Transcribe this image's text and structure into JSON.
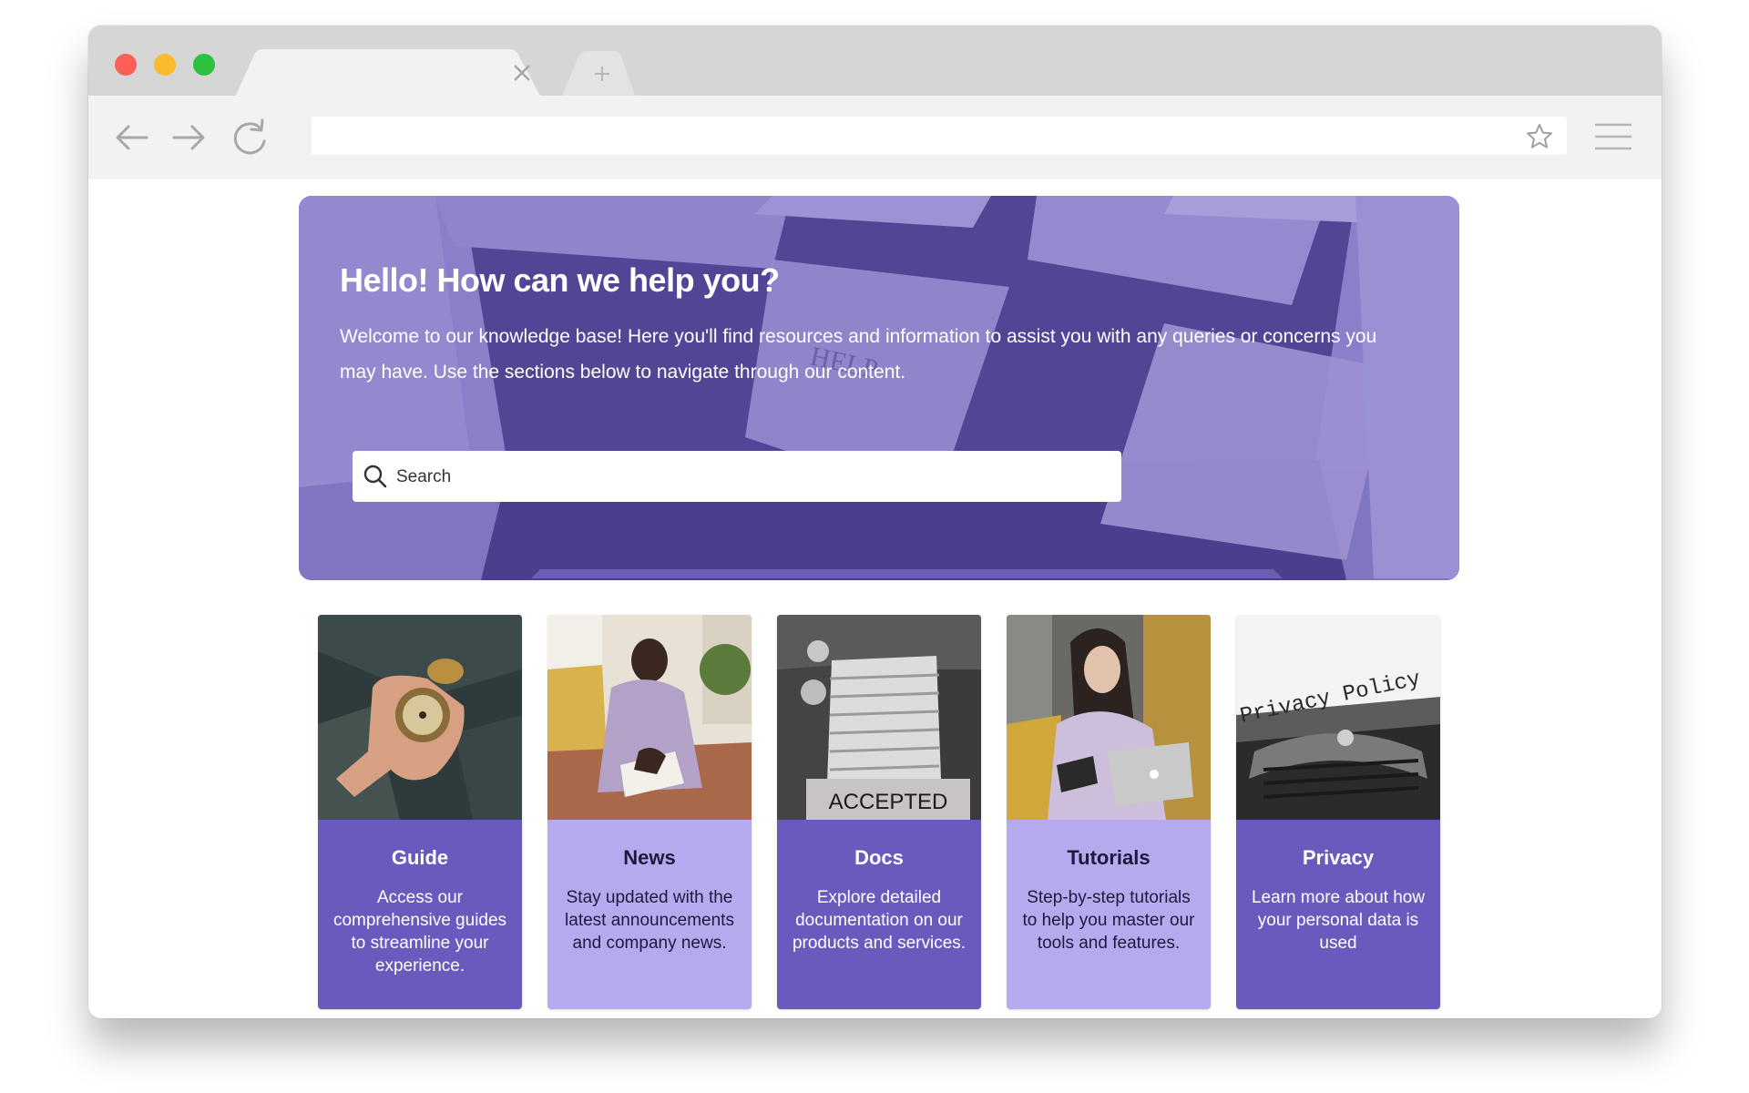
{
  "browser": {
    "tab_close_symbol": "×",
    "new_tab_symbol": "+",
    "url": ""
  },
  "hero": {
    "title": "Hello! How can we help you?",
    "description": "Welcome to our knowledge base! Here you'll find resources and information to assist you with any queries or concerns you may have. Use the sections below to navigate through our content.",
    "search_placeholder": "Search"
  },
  "cards": [
    {
      "title": "Guide",
      "description": "Access our comprehensive guides to streamline your experience.",
      "image": "compass-in-hand-photo"
    },
    {
      "title": "News",
      "description": "Stay updated with the latest announcements and company news.",
      "image": "man-reading-photo"
    },
    {
      "title": "Docs",
      "description": "Explore detailed documentation on our products and services.",
      "image": "stacked-papers-photo",
      "image_text": "ACCEPTED"
    },
    {
      "title": "Tutorials",
      "description": "Step-by-step tutorials to help you master our tools and features.",
      "image": "woman-with-laptop-photo"
    },
    {
      "title": "Privacy",
      "description": "Learn more about how your personal data is used",
      "image": "typewriter-photo",
      "image_text": "Privacy Policy"
    }
  ],
  "colors": {
    "hero_purple": "#8b80c9",
    "card_dark": "#6a5abe",
    "card_light": "#b5aaed"
  }
}
